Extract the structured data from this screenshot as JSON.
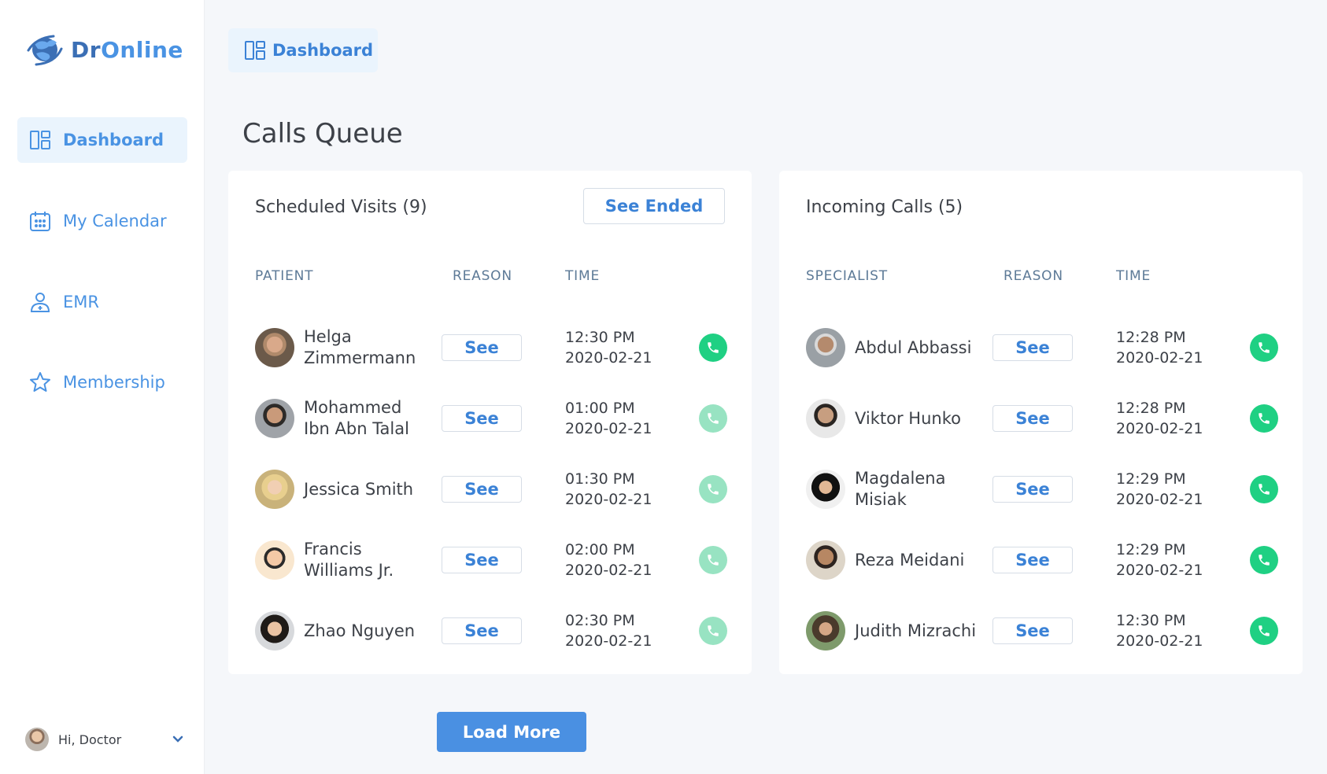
{
  "app": {
    "logo_dr": "Dr",
    "logo_online": "Online",
    "brand_color": "#4a93e3"
  },
  "sidebar": {
    "items": [
      {
        "label": "Dashboard",
        "icon": "dashboard-icon",
        "active": true
      },
      {
        "label": "My Calendar",
        "icon": "calendar-icon",
        "active": false
      },
      {
        "label": "EMR",
        "icon": "user-medical-icon",
        "active": false
      },
      {
        "label": "Membership",
        "icon": "star-icon",
        "active": false
      }
    ],
    "user": {
      "greeting": "Hi, Doctor",
      "icon": "chevron-down-icon"
    }
  },
  "header": {
    "tab_label": "Dashboard",
    "page_title": "Calls Queue"
  },
  "scheduled": {
    "title": "Scheduled Visits (9)",
    "see_ended": "See Ended",
    "columns": [
      "PATIENT",
      "REASON",
      "TIME"
    ],
    "rows": [
      {
        "line1": "Helga",
        "line2": "Zimmermann",
        "reason": "See",
        "time": "12:30 PM",
        "date": "2020-02-21",
        "call_active": true
      },
      {
        "line1": "Mohammed",
        "line2": "Ibn Abn Talal",
        "reason": "See",
        "time": "01:00 PM",
        "date": "2020-02-21",
        "call_active": false
      },
      {
        "line1": "Jessica Smith",
        "line2": "",
        "reason": "See",
        "time": "01:30 PM",
        "date": "2020-02-21",
        "call_active": false
      },
      {
        "line1": "Francis",
        "line2": "Williams Jr.",
        "reason": "See",
        "time": "02:00 PM",
        "date": "2020-02-21",
        "call_active": false
      },
      {
        "line1": "Zhao Nguyen",
        "line2": "",
        "reason": "See",
        "time": "02:30 PM",
        "date": "2020-02-21",
        "call_active": false
      }
    ]
  },
  "incoming": {
    "title": "Incoming Calls (5)",
    "columns": [
      "SPECIALIST",
      "REASON",
      "TIME"
    ],
    "rows": [
      {
        "line1": "Abdul Abbassi",
        "line2": "",
        "reason": "See",
        "time": "12:28 PM",
        "date": "2020-02-21",
        "call_active": true
      },
      {
        "line1": "Viktor Hunko",
        "line2": "",
        "reason": "See",
        "time": "12:28 PM",
        "date": "2020-02-21",
        "call_active": true
      },
      {
        "line1": "Magdalena",
        "line2": "Misiak",
        "reason": "See",
        "time": "12:29 PM",
        "date": "2020-02-21",
        "call_active": true
      },
      {
        "line1": "Reza Meidani",
        "line2": "",
        "reason": "See",
        "time": "12:29 PM",
        "date": "2020-02-21",
        "call_active": true
      },
      {
        "line1": "Judith Mizrachi",
        "line2": "",
        "reason": "See",
        "time": "12:30 PM",
        "date": "2020-02-21",
        "call_active": true
      }
    ]
  },
  "actions": {
    "load_more": "Load More"
  }
}
